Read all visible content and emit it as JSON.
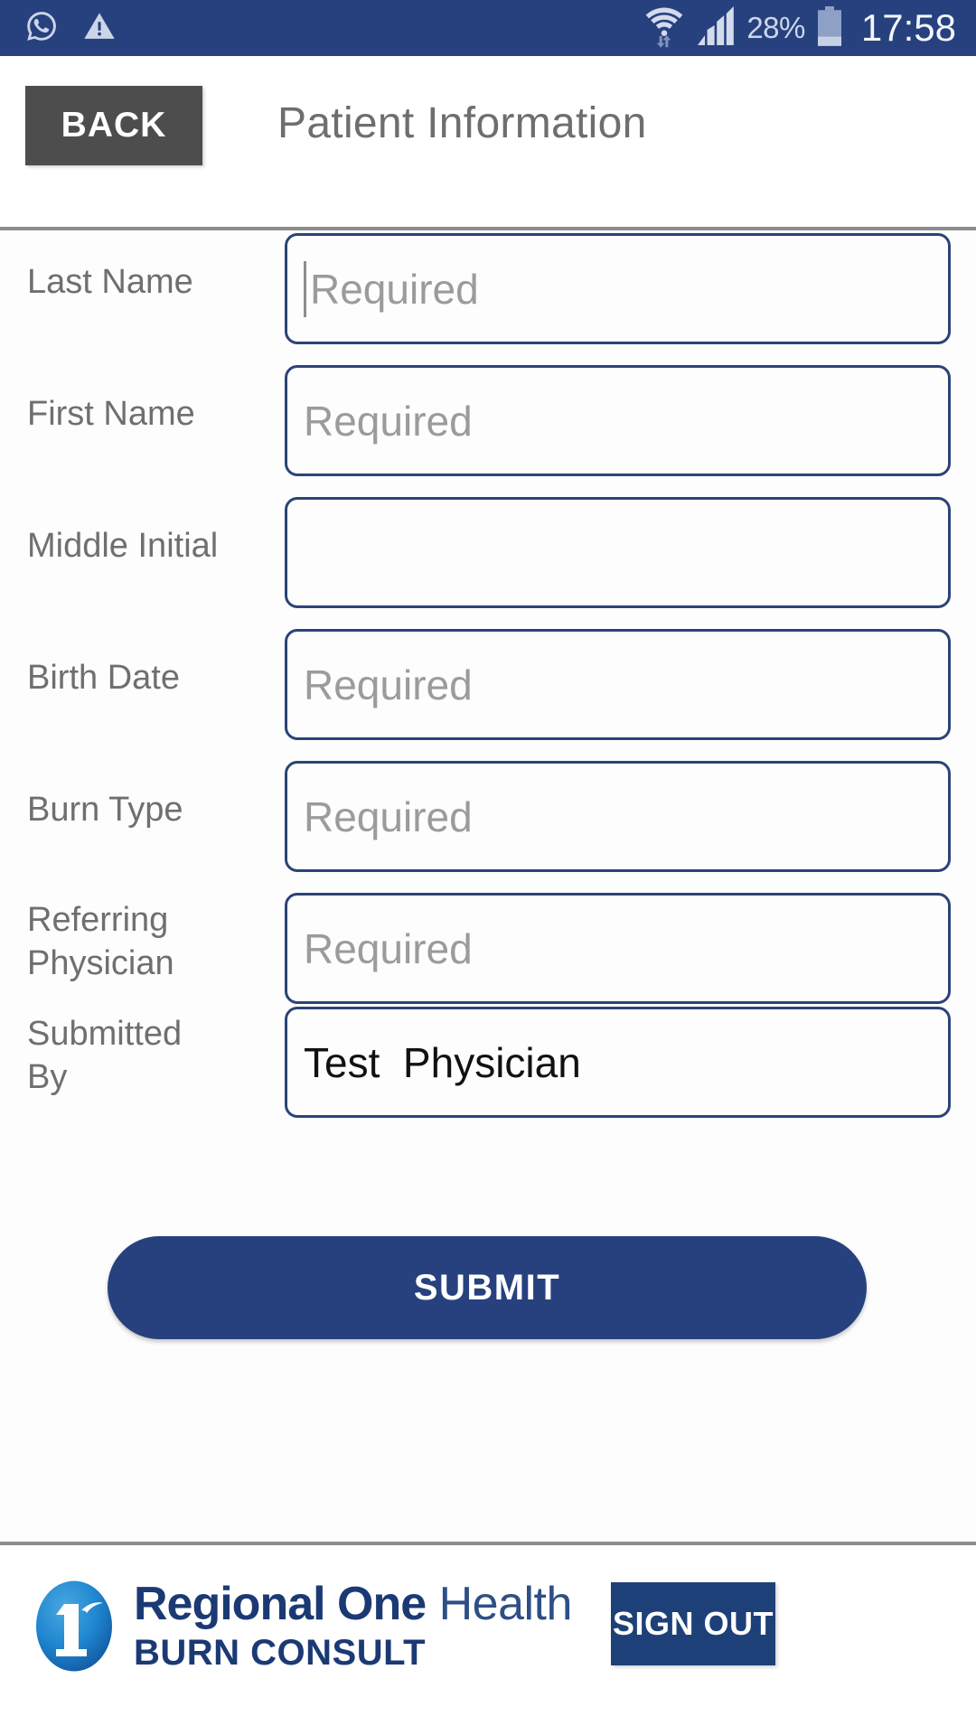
{
  "statusbar": {
    "icons_left": [
      "whatsapp-icon",
      "warning-triangle-icon"
    ],
    "wifi_icon": "wifi-data-transfer-icon",
    "signal_icon": "cellular-signal-icon",
    "battery_icon": "battery-icon",
    "battery_percent": "28%",
    "clock": "17:58",
    "background_color": "#27417e",
    "text_color": "#cdd6e8"
  },
  "header": {
    "back_label": "BACK",
    "title": "Patient Information"
  },
  "form": {
    "fields": [
      {
        "label": "Last Name",
        "placeholder": "Required",
        "value": "",
        "focused": true
      },
      {
        "label": "First Name",
        "placeholder": "Required",
        "value": "",
        "focused": false
      },
      {
        "label": "Middle Initial",
        "placeholder": "",
        "value": "",
        "focused": false
      },
      {
        "label": "Birth Date",
        "placeholder": "Required",
        "value": "",
        "focused": false
      },
      {
        "label": "Burn Type",
        "placeholder": "Required",
        "value": "",
        "focused": false
      },
      {
        "label": "Referring Physician",
        "placeholder": "Required",
        "value": "",
        "focused": false
      },
      {
        "label": "Submitted By",
        "placeholder": "",
        "value": "Test  Physician",
        "focused": false
      }
    ],
    "submit_label": "SUBMIT",
    "field_border_color": "#2b4377",
    "label_color": "#6f6f6f",
    "placeholder_color": "#9b9b9b"
  },
  "footer": {
    "logo_icon": "regional-one-health-logo-icon",
    "brand_primary": "Regional One",
    "brand_secondary": "Health",
    "brand_tagline": "BURN CONSULT",
    "signout_label": "SIGN OUT",
    "brand_color": "#1b3a74",
    "accent_color": "#1e4079"
  }
}
